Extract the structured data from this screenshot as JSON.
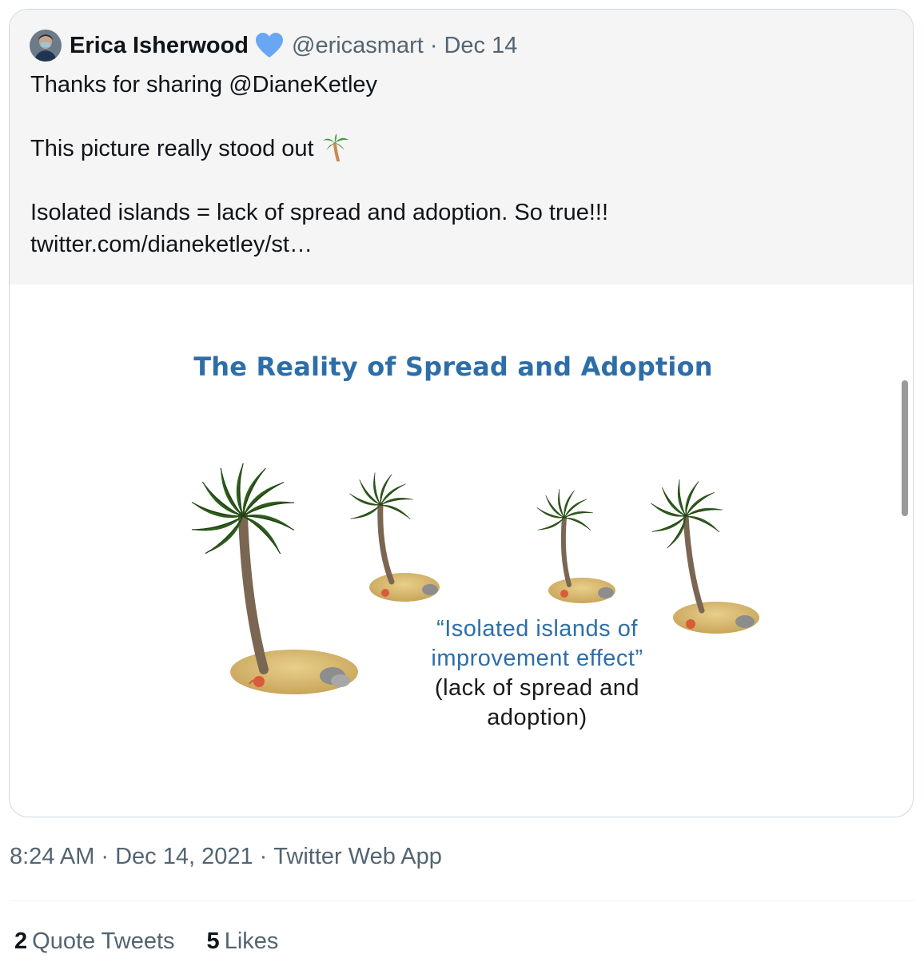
{
  "quoted_tweet": {
    "author_name": "Erica Isherwood",
    "handle": "@ericasmart",
    "separator": "·",
    "date": "Dec 14",
    "lines": [
      "Thanks for sharing @DianeKetley",
      "",
      "This picture really stood out",
      "",
      "Isolated islands = lack of spread and adoption. So true!!!",
      "twitter.com/dianeketley/st…"
    ],
    "verified_color": "#69a7f5",
    "emoji": "palm-tree"
  },
  "media_slide": {
    "title": "The Reality of Spread and Adoption",
    "caption_quote_line1": "“Isolated islands of",
    "caption_quote_line2": "improvement effect”",
    "caption_line3": "(lack of spread and",
    "caption_line4": "adoption)",
    "title_color": "#2e6ea8"
  },
  "tweet_meta": {
    "time": "8:24 AM",
    "separator": "·",
    "date": "Dec 14, 2021",
    "source": "Twitter Web App"
  },
  "stats": {
    "quote_tweets_count": "2",
    "quote_tweets_label": "Quote Tweets",
    "likes_count": "5",
    "likes_label": "Likes"
  }
}
